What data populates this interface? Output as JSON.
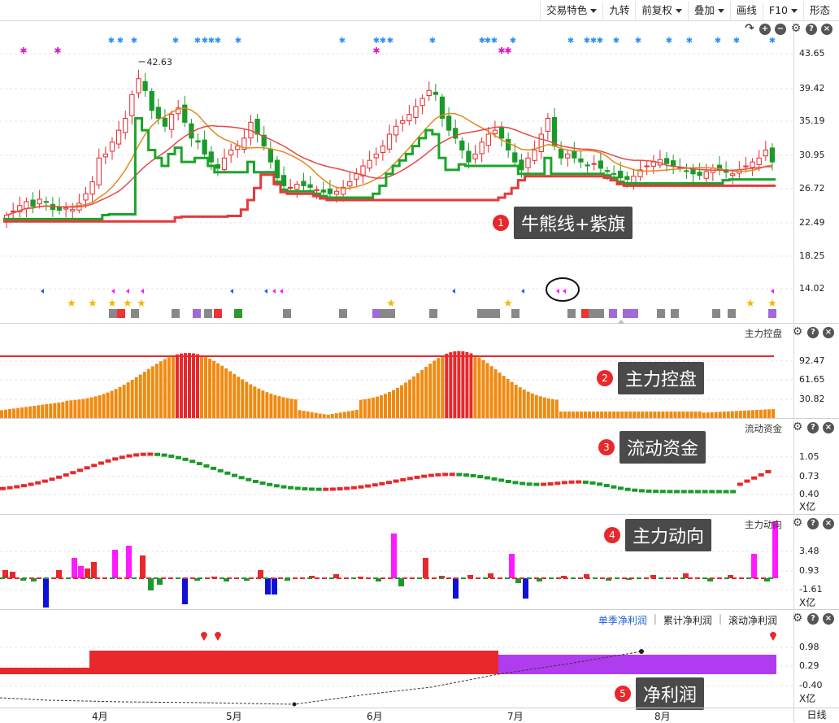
{
  "toolbar": {
    "buttons": [
      {
        "label": "交易特色",
        "caret": true
      },
      {
        "label": "九转",
        "caret": false
      },
      {
        "label": "前复权",
        "caret": true
      },
      {
        "label": "叠加",
        "caret": true
      },
      {
        "label": "画线",
        "caret": false
      },
      {
        "label": "F10",
        "caret": true
      },
      {
        "label": "形态",
        "caret": false
      }
    ]
  },
  "main_panel": {
    "axis_ticks": [
      "43.65",
      "39.42",
      "35.19",
      "30.95",
      "26.72",
      "22.49",
      "18.25",
      "14.02"
    ],
    "peak_label": "42.63",
    "callout": {
      "num": "1",
      "label": "牛熊线+紫旗"
    },
    "tool_icons": [
      "redo-icon",
      "zoom-in-icon",
      "zoom-out-icon",
      "gear-icon",
      "help-icon",
      "close-icon"
    ]
  },
  "panel2": {
    "title": "主力控盘",
    "axis_ticks": [
      "92.47",
      "61.65",
      "30.82"
    ],
    "callout": {
      "num": "2",
      "label": "主力控盘"
    }
  },
  "panel3": {
    "title": "流动资金",
    "axis_ticks": [
      "1.05",
      "0.73",
      "0.40"
    ],
    "unit": "X亿",
    "callout": {
      "num": "3",
      "label": "流动资金"
    }
  },
  "panel4": {
    "title": "主力动向",
    "axis_ticks": [
      "3.48",
      "0.93",
      "-1.61"
    ],
    "unit": "X亿",
    "callout": {
      "num": "4",
      "label": "主力动向"
    }
  },
  "panel5": {
    "tabs": [
      "单季净利润",
      "累计净利润",
      "滚动净利润"
    ],
    "active_tab": "单季净利润",
    "axis_ticks": [
      "0.98",
      "0.29",
      "-0.40"
    ],
    "unit": "X亿",
    "callout": {
      "num": "5",
      "label": "净利润"
    }
  },
  "xaxis": {
    "months": [
      "4月",
      "5月",
      "6月",
      "7月",
      "8月"
    ],
    "period_button": "日线"
  },
  "colors": {
    "up": "#e8282b",
    "down": "#1a9a2a",
    "bull_line": "#1aa52a",
    "bear_line": "#e83a3a",
    "ma_orange": "#e08a1e",
    "bar_orange": "#f08a10",
    "magenta": "#ff1aff",
    "blue": "#1010d8",
    "purple": "#b03cf0"
  }
}
